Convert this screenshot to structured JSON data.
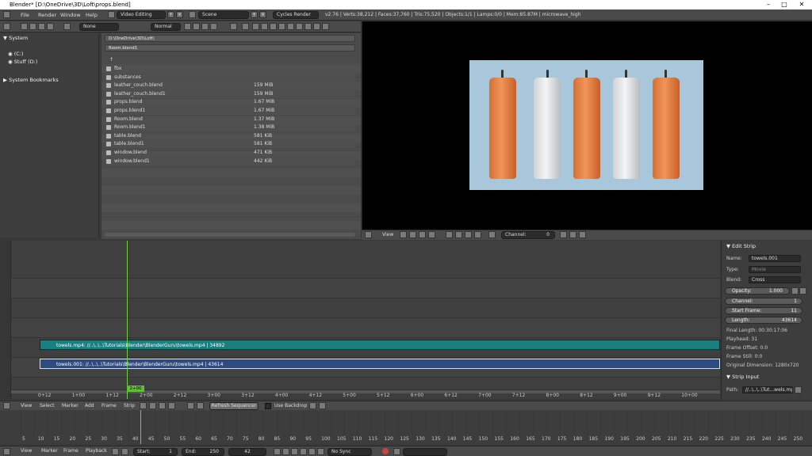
{
  "window": {
    "title": "Blender* [D:\\OneDrive\\3D\\Loft\\props.blend]",
    "minimize": "–",
    "maximize": "□",
    "close": "✕"
  },
  "topbar": {
    "menus": [
      "File",
      "Render",
      "Window",
      "Help"
    ],
    "screen_layout": "Video Editing",
    "scene": "Scene",
    "engine": "Cycles Render",
    "stats": "v2.76 | Verts:38,212 | Faces:37,760 | Tris:75,520 | Objects:1/1 | Lamps:0/0 | Mem:85.87M | microwave_high"
  },
  "file_browser": {
    "filter_dropdown": "None",
    "display_dropdown": "Normal",
    "system_header": "System",
    "drives": [
      "(C:)",
      "Stuff (D:)"
    ],
    "bookmarks_header": "System Bookmarks",
    "path": "D:\\OneDrive\\3D\\Loft\\",
    "filename": "Room.blend1",
    "up_icon": "↑",
    "files": [
      {
        "name": "fbx",
        "size": ""
      },
      {
        "name": "substances",
        "size": ""
      },
      {
        "name": "leather_couch.blend",
        "size": "159 MiB"
      },
      {
        "name": "leather_couch.blend1",
        "size": "159 MiB"
      },
      {
        "name": "props.blend",
        "size": "1.67 MiB"
      },
      {
        "name": "props.blend1",
        "size": "1.67 MiB"
      },
      {
        "name": "Room.blend",
        "size": "1.37 MiB"
      },
      {
        "name": "Room.blend1",
        "size": "1.38 MiB"
      },
      {
        "name": "table.blend",
        "size": "581 KiB"
      },
      {
        "name": "table.blend1",
        "size": "581 KiB"
      },
      {
        "name": "window.blend",
        "size": "471 KiB"
      },
      {
        "name": "window.blend1",
        "size": "442 KiB"
      }
    ]
  },
  "preview_header": {
    "view": "View",
    "channel_label": "Channel:",
    "channel_value": "0"
  },
  "sequencer": {
    "strips": [
      {
        "label": "towels.mp4: //..\\..\\..\\Tutorials\\Blender\\BlenderGuru\\towels.mp4 | 34892",
        "color": "#1a7f7f"
      },
      {
        "label": "towels.001: //..\\..\\..\\Tutorials\\Blender\\BlenderGuru\\towels.mp4 | 43614",
        "color": "#2f4b7c"
      }
    ],
    "current_frame": "2+00",
    "ruler": [
      "0+12",
      "1+00",
      "1+12",
      "2+00",
      "2+12",
      "3+00",
      "3+12",
      "4+00",
      "4+12",
      "5+00",
      "5+12",
      "6+00",
      "6+12",
      "7+00",
      "7+12",
      "8+00",
      "8+12",
      "9+00",
      "9+12",
      "10+00"
    ]
  },
  "properties": {
    "edit_strip_header": "Edit Strip",
    "name_label": "Name:",
    "name_value": "towels.001",
    "type_label": "Type:",
    "type_value": "Movie",
    "blend_label": "Blend:",
    "blend_value": "Cross",
    "opacity_label": "Opacity:",
    "opacity_value": "1.000",
    "channel_label": "Channel:",
    "channel_value": "1",
    "start_frame_label": "Start Frame:",
    "start_frame_value": "11",
    "length_label": "Length:",
    "length_value": "43614",
    "final_length": "Final Length: 00:30:17:06",
    "playhead": "Playhead: 31",
    "frame_offset": "Frame Offset: 0:0",
    "frame_still": "Frame Still: 0:0",
    "original_dimension": "Original Dimension: 1280x720",
    "strip_input_header": "Strip Input",
    "path_label": "Path:",
    "path_value": "//..\\..\\..\\Tut...wels.mp4"
  },
  "sequencer_header": {
    "menus": [
      "View",
      "Select",
      "Marker",
      "Add",
      "Frame",
      "Strip"
    ],
    "refresh": "Refresh Sequencer",
    "use_backdrop": "Use Backdrop"
  },
  "timeline": {
    "ticks": [
      "5",
      "10",
      "15",
      "20",
      "25",
      "30",
      "35",
      "40",
      "45",
      "50",
      "55",
      "60",
      "65",
      "70",
      "75",
      "80",
      "85",
      "90",
      "95",
      "100",
      "105",
      "110",
      "115",
      "120",
      "125",
      "130",
      "135",
      "140",
      "145",
      "150",
      "155",
      "160",
      "165",
      "170",
      "175",
      "180",
      "185",
      "190",
      "195",
      "200",
      "205",
      "210",
      "215",
      "220",
      "225",
      "230",
      "235",
      "240",
      "245",
      "250"
    ]
  },
  "timeline_header": {
    "menus": [
      "View",
      "Marker",
      "Frame",
      "Playback"
    ],
    "start_label": "Start:",
    "start_value": "1",
    "end_label": "End:",
    "end_value": "250",
    "current_frame": "42",
    "sync": "No Sync"
  }
}
